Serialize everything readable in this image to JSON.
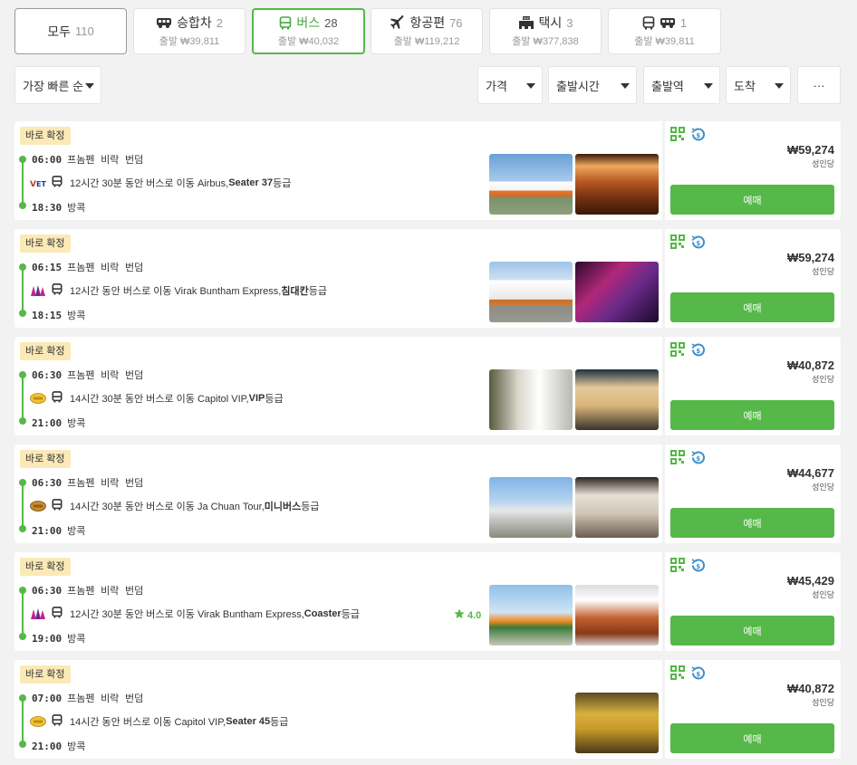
{
  "tabs": [
    {
      "label": "모두",
      "count": "110",
      "price": ""
    },
    {
      "label": "승합차",
      "count": "2",
      "price": "출발 ₩39,811"
    },
    {
      "label": "버스",
      "count": "28",
      "price": "출발 ₩40,032"
    },
    {
      "label": "항공편",
      "count": "76",
      "price": "출발 ₩119,212"
    },
    {
      "label": "택시",
      "count": "3",
      "price": "출발 ₩377,838"
    },
    {
      "label": "",
      "count": "1",
      "price": "출발 ₩39,811"
    }
  ],
  "filters": {
    "sort": "가장 빠른 순",
    "price": "가격",
    "depart_time": "출발시간",
    "depart_station": "출발역",
    "arrival": "도착",
    "more": "···"
  },
  "colors": {
    "accent": "#55b848",
    "badge": "#fbe9b7"
  },
  "trips": [
    {
      "badge": "바로 확정",
      "dep_time": "06:00",
      "dep_place": "프놈펜 비락 번덤",
      "desc": "12시간 30분 동안 버스로 이동 Airbus, ",
      "cls": "Seater 37",
      "cls_suffix": " 등급",
      "arr_time": "18:30",
      "arr_place": "방콕",
      "rating": "",
      "operator_logo": "vet-logo",
      "price": "₩59,274",
      "per": "성인당",
      "buy": "예매"
    },
    {
      "badge": "바로 확정",
      "dep_time": "06:15",
      "dep_place": "프놈펜 비락 번덤",
      "desc": "12시간 동안 버스로 이동 Virak Buntham Express, ",
      "cls": "침대칸",
      "cls_suffix": " 등급",
      "arr_time": "18:15",
      "arr_place": "방콕",
      "rating": "",
      "operator_logo": "virak-logo",
      "price": "₩59,274",
      "per": "성인당",
      "buy": "예매"
    },
    {
      "badge": "바로 확정",
      "dep_time": "06:30",
      "dep_place": "프놈펜 비락 번덤",
      "desc": "14시간 30분 동안 버스로 이동 Capitol VIP, ",
      "cls": "VIP",
      "cls_suffix": " 등급",
      "arr_time": "21:00",
      "arr_place": "방콕",
      "rating": "",
      "operator_logo": "capitol-logo",
      "price": "₩40,872",
      "per": "성인당",
      "buy": "예매"
    },
    {
      "badge": "바로 확정",
      "dep_time": "06:30",
      "dep_place": "프놈펜 비락 번덤",
      "desc": "14시간 30분 동안 버스로 이동 Ja Chuan Tour, ",
      "cls": "미니버스",
      "cls_suffix": " 등급",
      "arr_time": "21:00",
      "arr_place": "방콕",
      "rating": "",
      "operator_logo": "jachuan-logo",
      "price": "₩44,677",
      "per": "성인당",
      "buy": "예매"
    },
    {
      "badge": "바로 확정",
      "dep_time": "06:30",
      "dep_place": "프놈펜 비락 번덤",
      "desc": "12시간 30분 동안 버스로 이동 Virak Buntham Express, ",
      "cls": "Coaster",
      "cls_suffix": " 등급",
      "arr_time": "19:00",
      "arr_place": "방콕",
      "rating": "4.0",
      "operator_logo": "virak-logo",
      "price": "₩45,429",
      "per": "성인당",
      "buy": "예매"
    },
    {
      "badge": "바로 확정",
      "dep_time": "07:00",
      "dep_place": "프놈펜 비락 번덤",
      "desc": "14시간 동안 버스로 이동 Capitol VIP, ",
      "cls": "Seater 45",
      "cls_suffix": " 등급",
      "arr_time": "21:00",
      "arr_place": "방콕",
      "rating": "",
      "operator_logo": "capitol-logo",
      "price": "₩40,872",
      "per": "성인당",
      "buy": "예매"
    }
  ]
}
